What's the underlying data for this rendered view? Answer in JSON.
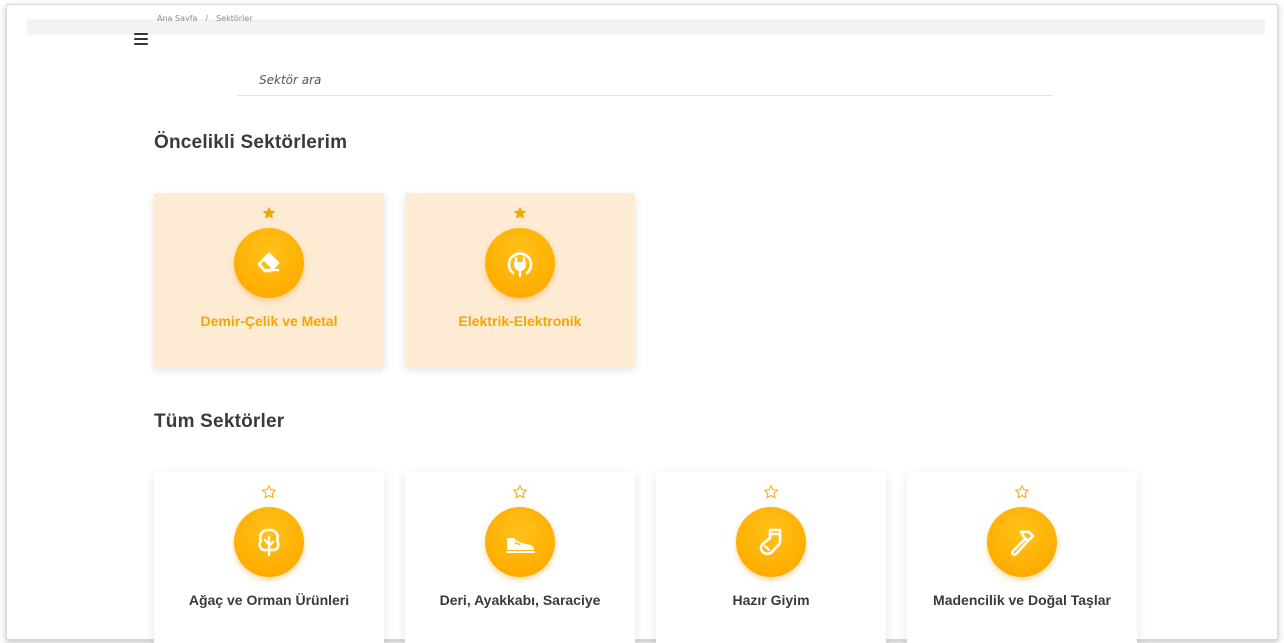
{
  "breadcrumb": [
    "Ana Sayfa",
    "/",
    "Sektörler"
  ],
  "search": {
    "placeholder": "Sektör ara"
  },
  "sections": {
    "favorites_title": "Öncelikli Sektörlerim",
    "all_title": "Tüm Sektörler"
  },
  "favorites": [
    {
      "label": "Demir-Çelik ve Metal",
      "icon": "eraser-icon",
      "starred": true
    },
    {
      "label": "Elektrik-Elektronik",
      "icon": "plug-icon",
      "starred": true
    }
  ],
  "all": [
    {
      "label": "Ağaç ve Orman Ürünleri",
      "icon": "tree-icon",
      "starred": false
    },
    {
      "label": "Deri, Ayakkabı, Saraciye",
      "icon": "shoe-icon",
      "starred": false
    },
    {
      "label": "Hazır Giyim",
      "icon": "sock-icon",
      "starred": false
    },
    {
      "label": "Madencilik ve Doğal Taşlar",
      "icon": "hammer-icon",
      "starred": false
    }
  ],
  "colors": {
    "accent": "#ffad00",
    "favorite_bg": "#fdebd4",
    "accent_text": "#f5a400"
  }
}
